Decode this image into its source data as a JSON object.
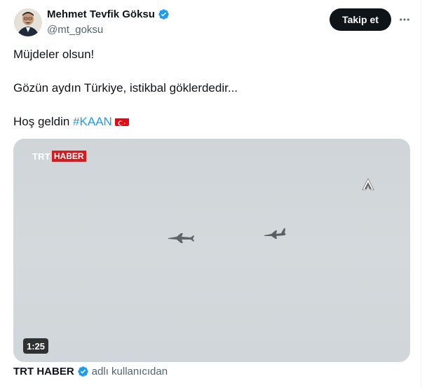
{
  "author": {
    "display_name": "Mehmet Tevfik Göksu",
    "handle": "@mt_goksu",
    "avatar_icon": "person-avatar",
    "verified_icon": "verified-badge-icon"
  },
  "actions": {
    "follow_label": "Takip et",
    "more_icon": "more-options-icon"
  },
  "tweet": {
    "line1": "Müjdeler olsun!",
    "line2": "Gözün aydın Türkiye, istikbal göklerdedir...",
    "line3_prefix": "Hoş geldin ",
    "hashtag": "#KAAN",
    "flag_icon": "turkey-flag-emoji"
  },
  "media": {
    "watermark_trt": "TRT",
    "watermark_haber": "HABER",
    "agency_logo_icon": "anadolu-agency-logo",
    "duration": "1:25"
  },
  "attribution": {
    "source_name": "TRT HABER",
    "suffix": "adlı kullanıcıdan"
  },
  "colors": {
    "accent": "#1d9bf0",
    "text": "#0f1419",
    "muted": "#536471",
    "trt_red": "#d71a20"
  }
}
